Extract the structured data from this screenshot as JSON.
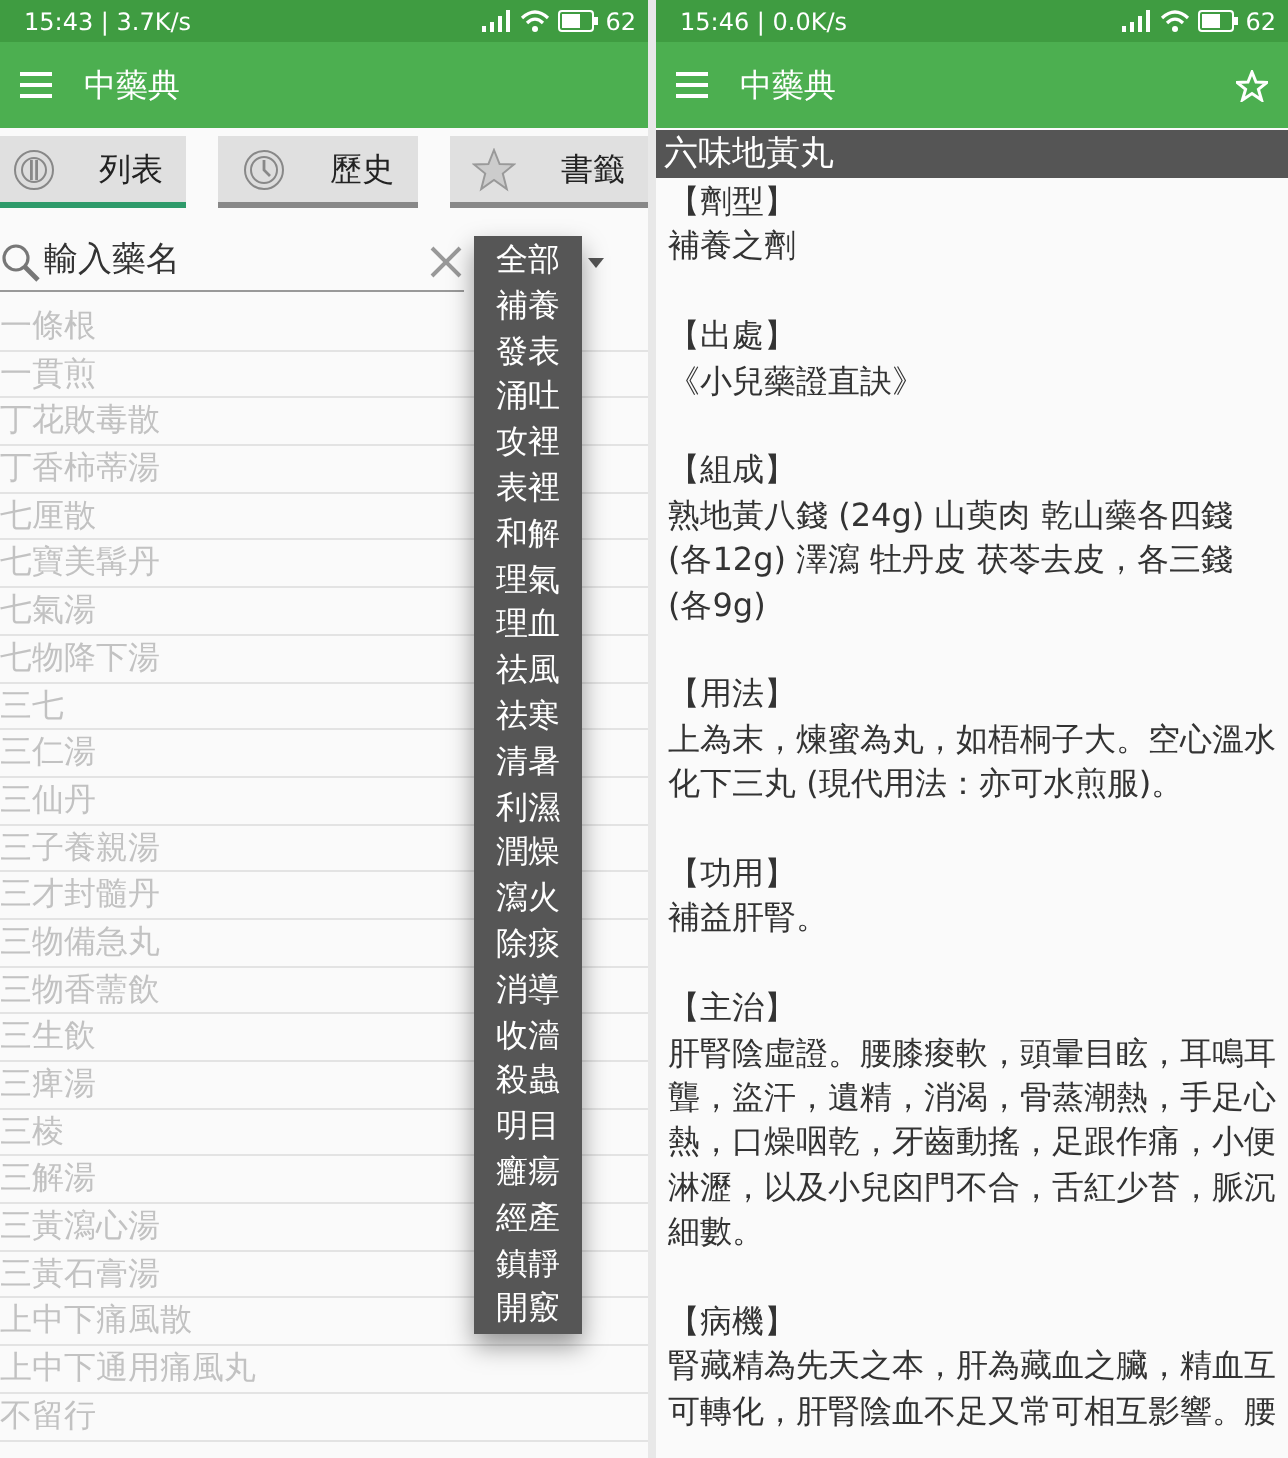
{
  "left_screen": {
    "status_bar": {
      "time": "15:43 | 3.7K/s",
      "battery": "62"
    },
    "toolbar": {
      "title": "中藥典"
    },
    "tabs": [
      {
        "label": "列表",
        "selected": true
      },
      {
        "label": "歷史",
        "selected": false
      },
      {
        "label": "書籤",
        "selected": false
      }
    ],
    "search": {
      "placeholder": "輸入藥名"
    },
    "category_dropdown": {
      "expanded": true,
      "options": [
        "全部",
        "補養",
        "發表",
        "涌吐",
        "攻裡",
        "表裡",
        "和解",
        "理氣",
        "理血",
        "祛風",
        "祛寒",
        "清暑",
        "利濕",
        "潤燥",
        "瀉火",
        "除痰",
        "消導",
        "收濇",
        "殺蟲",
        "明目",
        "癰瘍",
        "經產",
        "鎮靜",
        "開竅"
      ]
    },
    "list": [
      "一條根",
      "一貫煎",
      "丁花敗毒散",
      "丁香柿蒂湯",
      "七厘散",
      "七寶美髯丹",
      "七氣湯",
      "七物降下湯",
      "三七",
      "三仁湯",
      "三仙丹",
      "三子養親湯",
      "三才封髓丹",
      "三物備急丸",
      "三物香薷飲",
      "三生飲",
      "三痺湯",
      "三棱",
      "三解湯",
      "三黃瀉心湯",
      "三黃石膏湯",
      "上中下痛風散",
      "上中下通用痛風丸",
      "不留行"
    ]
  },
  "right_screen": {
    "status_bar": {
      "time": "15:46 | 0.0K/s",
      "battery": "62"
    },
    "toolbar": {
      "title": "中藥典"
    },
    "entry_title": "六味地黃丸",
    "sections": [
      {
        "heading": "【劑型】",
        "body": "補養之劑"
      },
      {
        "heading": "【出處】",
        "body": "《小兒藥證直訣》"
      },
      {
        "heading": "【組成】",
        "body": "熟地黃八錢 (24g) 山萸肉 乾山藥各四錢 (各12g) 澤瀉 牡丹皮 茯苓去皮，各三錢 (各9g)"
      },
      {
        "heading": "【用法】",
        "body": "上為末，煉蜜為丸，如梧桐子大。空心溫水化下三丸 (現代用法：亦可水煎服)。"
      },
      {
        "heading": "【功用】",
        "body": "補益肝腎。"
      },
      {
        "heading": "【主治】",
        "body": "肝腎陰虛證。腰膝痠軟，頭暈目眩，耳鳴耳聾，盜汗，遺精，消渴，骨蒸潮熱，手足心熱，口燥咽乾，牙齒動搖，足跟作痛，小便淋瀝，以及小兒囟門不合，舌紅少苔，脈沉細數。"
      },
      {
        "heading": "【病機】",
        "body": "腎藏精為先天之本，肝為藏血之臟，精血互可轉化，肝腎陰血不足又常可相互影響。腰"
      }
    ]
  }
}
